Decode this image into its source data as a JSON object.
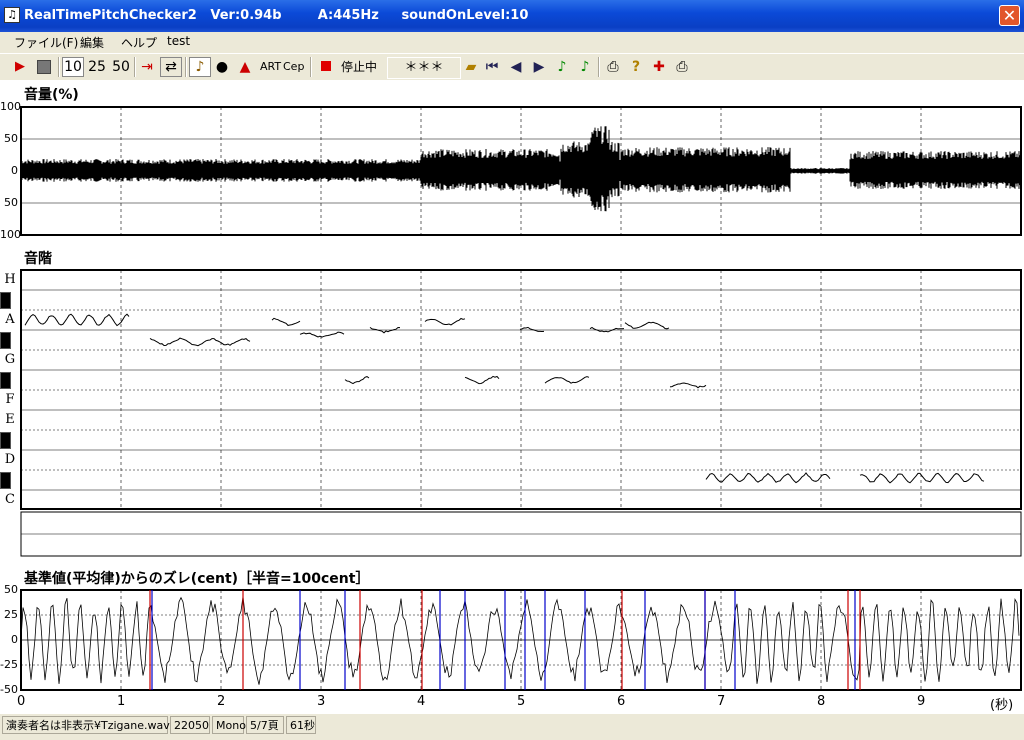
{
  "window": {
    "title": "RealTimePitchChecker2   Ver:0.94b        A:445Hz     soundOnLevel:10",
    "icon_glyph": "♫"
  },
  "menu": [
    "ファイル(F)",
    "編集",
    "ヘルプ",
    "test"
  ],
  "toolbar": {
    "zoom_10": "10",
    "zoom_25": "25",
    "zoom_50": "50",
    "art_label": "ART",
    "cep_label": "Cep",
    "status_label": "停止中",
    "note_display": "＊＊＊"
  },
  "volume_panel": {
    "title": "音量(%)",
    "y_labels": [
      "100",
      "50",
      "0",
      "50",
      "100"
    ]
  },
  "scale_panel": {
    "title": "音階",
    "notes": [
      "H",
      "A",
      "G",
      "F",
      "E",
      "D",
      "C"
    ]
  },
  "cent_panel": {
    "title": "基準値(平均律)からのズレ(cent)［半音=100cent］",
    "y_labels": [
      "50",
      "25",
      "0",
      "-25",
      "-50"
    ]
  },
  "time_axis": {
    "ticks": [
      "0",
      "1",
      "2",
      "3",
      "4",
      "5",
      "6",
      "7",
      "8",
      "9"
    ],
    "unit": "(秒)"
  },
  "statusbar": {
    "file": "演奏者名は非表示¥Tzigane.wav",
    "rate": "22050",
    "channels": "Mono",
    "page": "5/7頁",
    "duration": "61秒"
  },
  "colors": {
    "titlebar": "#0a3fc4",
    "waveform": "#000000",
    "cent_red": "#cc0000",
    "cent_blue": "#0000cc"
  }
}
